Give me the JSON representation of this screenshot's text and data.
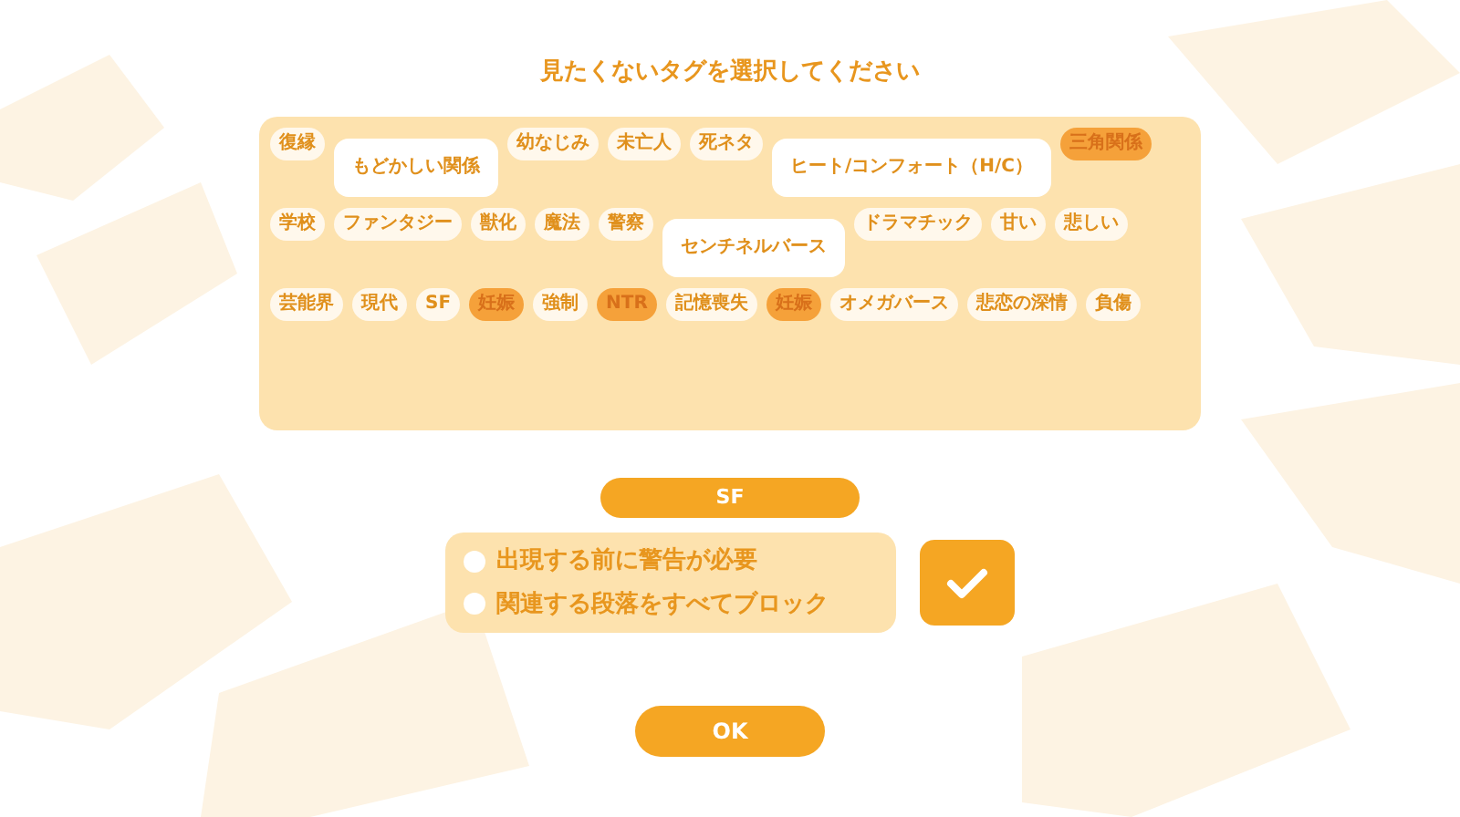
{
  "title": "見たくないタグを選択してください",
  "tags": [
    {
      "label": "復縁",
      "selected": false,
      "kind": "small"
    },
    {
      "label": "もどかしい関係",
      "selected": false,
      "kind": "large"
    },
    {
      "label": "幼なじみ",
      "selected": false,
      "kind": "small"
    },
    {
      "label": "未亡人",
      "selected": false,
      "kind": "small"
    },
    {
      "label": "死ネタ",
      "selected": false,
      "kind": "small"
    },
    {
      "label": "ヒート/コンフォート（H/C）",
      "selected": false,
      "kind": "large"
    },
    {
      "label": "三角関係",
      "selected": true,
      "kind": "small"
    },
    {
      "label": "学校",
      "selected": false,
      "kind": "small"
    },
    {
      "label": "ファンタジー",
      "selected": false,
      "kind": "small"
    },
    {
      "label": "獣化",
      "selected": false,
      "kind": "small"
    },
    {
      "label": "魔法",
      "selected": false,
      "kind": "small"
    },
    {
      "label": "警察",
      "selected": false,
      "kind": "small"
    },
    {
      "label": "センチネルバース",
      "selected": false,
      "kind": "large"
    },
    {
      "label": "ドラマチック",
      "selected": false,
      "kind": "small"
    },
    {
      "label": "甘い",
      "selected": false,
      "kind": "small"
    },
    {
      "label": "悲しい",
      "selected": false,
      "kind": "small"
    },
    {
      "label": "芸能界",
      "selected": false,
      "kind": "small"
    },
    {
      "label": "現代",
      "selected": false,
      "kind": "small"
    },
    {
      "label": "SF",
      "selected": false,
      "kind": "small"
    },
    {
      "label": "妊娠",
      "selected": true,
      "kind": "small"
    },
    {
      "label": "強制",
      "selected": false,
      "kind": "small"
    },
    {
      "label": "NTR",
      "selected": true,
      "kind": "small"
    },
    {
      "label": "記憶喪失",
      "selected": false,
      "kind": "small"
    },
    {
      "label": "妊娠",
      "selected": true,
      "kind": "small"
    },
    {
      "label": "オメガバース",
      "selected": false,
      "kind": "small"
    },
    {
      "label": "悲恋の深情",
      "selected": false,
      "kind": "small"
    },
    {
      "label": "負傷",
      "selected": false,
      "kind": "small"
    }
  ],
  "current_tag": "SF",
  "options": [
    {
      "label": "出現する前に警告が必要",
      "selected": false
    },
    {
      "label": "関連する段落をすべてブロック",
      "selected": false
    }
  ],
  "ok_button": "OK"
}
